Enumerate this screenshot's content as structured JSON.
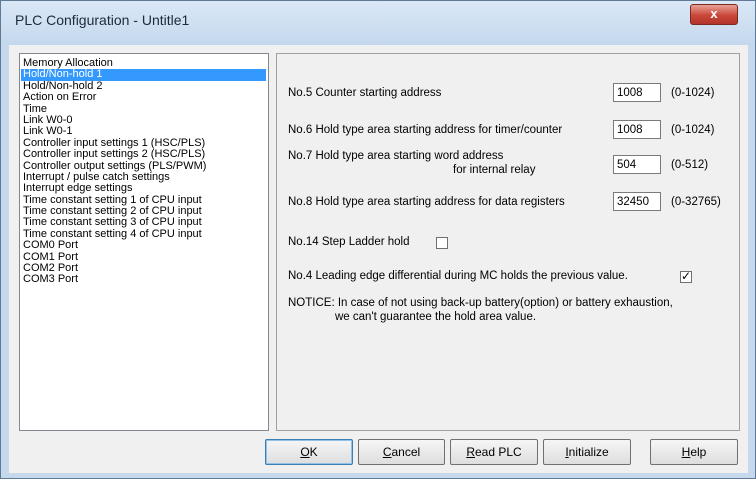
{
  "window": {
    "title": "PLC Configuration - Untitle1",
    "close_glyph": "x"
  },
  "sidebar": {
    "selected_index": 1,
    "items": [
      "Memory Allocation",
      "Hold/Non-hold 1",
      "Hold/Non-hold 2",
      "Action on Error",
      "Time",
      "Link W0-0",
      "Link W0-1",
      "Controller input settings 1 (HSC/PLS)",
      "Controller input settings 2 (HSC/PLS)",
      "Controller output settings (PLS/PWM)",
      "Interrupt / pulse catch settings",
      "Interrupt edge settings",
      "Time constant setting 1 of CPU input",
      "Time constant setting 2 of CPU input",
      "Time constant setting 3 of CPU input",
      "Time constant setting 4 of CPU input",
      "COM0 Port",
      "COM1 Port",
      "COM2 Port",
      "COM3 Port"
    ]
  },
  "settings": {
    "counter_start": {
      "label": "No.5 Counter starting address",
      "value": "1008",
      "range": "(0-1024)"
    },
    "timer_counter_hold": {
      "label": "No.6 Hold type area starting address for timer/counter",
      "value": "1008",
      "range": "(0-1024)"
    },
    "relay_hold": {
      "label_line1": "No.7 Hold type area starting word address",
      "label_line2": "for internal relay",
      "value": "504",
      "range": "(0-512)"
    },
    "register_hold": {
      "label": "No.8 Hold type area starting address for data registers",
      "value": "32450",
      "range": "(0-32765)"
    },
    "step_ladder": {
      "label": "No.14 Step Ladder hold",
      "checked": false
    },
    "leading_edge": {
      "label": "No.4 Leading edge differential during MC holds the previous value.",
      "checked": true,
      "check_glyph": "✓"
    },
    "notice_line1": "NOTICE: In case of not using back-up battery(option) or battery exhaustion,",
    "notice_line2": "we can't guarantee the hold area value."
  },
  "buttons": {
    "ok": {
      "mnemonic": "O",
      "rest": "K"
    },
    "cancel": {
      "mnemonic": "C",
      "rest": "ancel"
    },
    "read_plc": {
      "mnemonic": "R",
      "rest": "ead PLC"
    },
    "initialize": {
      "mnemonic": "I",
      "rest": "nitialize"
    },
    "help": {
      "mnemonic": "H",
      "rest": "elp"
    }
  },
  "icons": {
    "close": "close-icon",
    "check": "checkmark-icon"
  }
}
